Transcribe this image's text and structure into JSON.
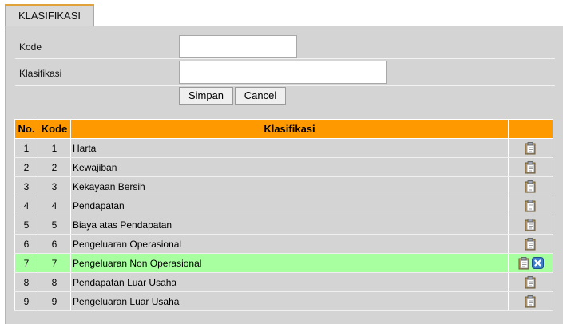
{
  "tab": {
    "label": "KLASIFIKASI"
  },
  "form": {
    "kode_label": "Kode",
    "kode_value": "",
    "klasifikasi_label": "Klasifikasi",
    "klasifikasi_value": "",
    "save_label": "Simpan",
    "cancel_label": "Cancel"
  },
  "table": {
    "headers": {
      "no": "No.",
      "kode": "Kode",
      "klasifikasi": "Klasifikasi",
      "action": ""
    },
    "rows": [
      {
        "no": "1",
        "kode": "1",
        "klasifikasi": "Harta"
      },
      {
        "no": "2",
        "kode": "2",
        "klasifikasi": "Kewajiban"
      },
      {
        "no": "3",
        "kode": "3",
        "klasifikasi": "Kekayaan Bersih"
      },
      {
        "no": "4",
        "kode": "4",
        "klasifikasi": "Pendapatan"
      },
      {
        "no": "5",
        "kode": "5",
        "klasifikasi": "Biaya atas Pendapatan"
      },
      {
        "no": "6",
        "kode": "6",
        "klasifikasi": "Pengeluaran Operasional"
      },
      {
        "no": "7",
        "kode": "7",
        "klasifikasi": "Pengeluaran Non Operasional"
      },
      {
        "no": "8",
        "kode": "8",
        "klasifikasi": "Pendapatan Luar Usaha"
      },
      {
        "no": "9",
        "kode": "9",
        "klasifikasi": "Pengeluaran Luar Usaha"
      }
    ],
    "highlighted_row": 7
  },
  "icons": {
    "edit": "clipboard-icon",
    "delete": "delete-icon"
  },
  "colors": {
    "header": "#ff9900",
    "highlight": "#a7ffa0",
    "panel": "#d4d4d4",
    "tab_accent": "#e0a33a"
  }
}
